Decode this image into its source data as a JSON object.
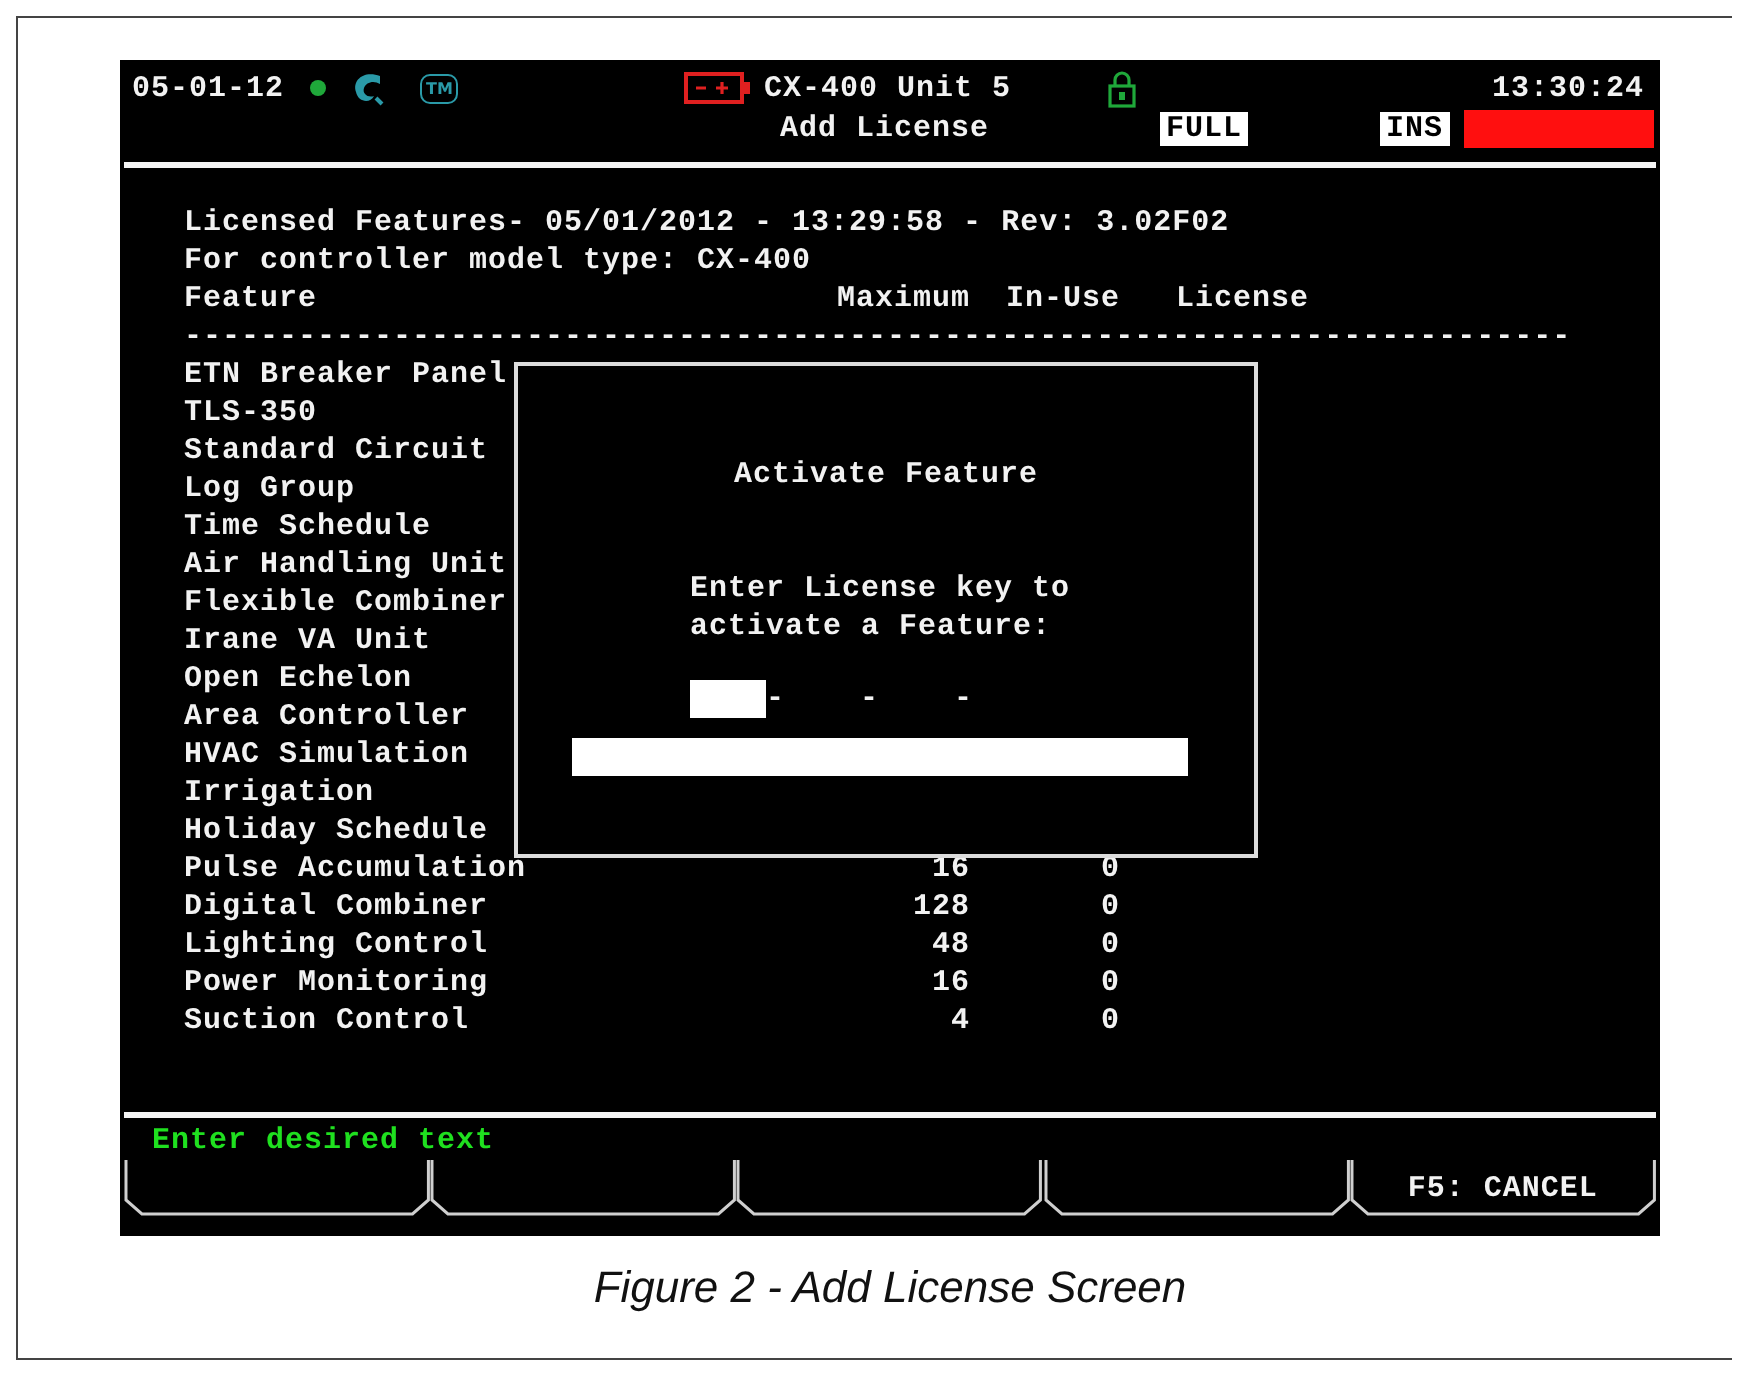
{
  "header": {
    "date": "05-01-12",
    "tm_badge": "TM",
    "unit": "CX-400 Unit 5",
    "time": "13:30:24",
    "screen_title": "Add License",
    "mode_badges": [
      "FULL",
      "INS"
    ]
  },
  "report": {
    "title_line": "Licensed Features- 05/01/2012 - 13:29:58 - Rev: 3.02F02",
    "model_line": "For controller model type: CX-400",
    "columns": [
      "Feature",
      "Maximum",
      "In-Use",
      "License"
    ],
    "rule": "-------------------------------------------------------------------------",
    "rows": [
      {
        "feature": "ETN Breaker Panel"
      },
      {
        "feature": "TLS-350"
      },
      {
        "feature": "Standard Circuit"
      },
      {
        "feature": "Log Group"
      },
      {
        "feature": "Time Schedule"
      },
      {
        "feature": "Air Handling Unit"
      },
      {
        "feature": "Flexible Combiner"
      },
      {
        "feature": "Irane VA Unit"
      },
      {
        "feature": "Open Echelon"
      },
      {
        "feature": "Area Controller"
      },
      {
        "feature": "HVAC Simulation"
      },
      {
        "feature": "Irrigation"
      },
      {
        "feature": "Holiday Schedule"
      },
      {
        "feature": "Pulse Accumulation",
        "maximum": "16",
        "in_use": "0"
      },
      {
        "feature": "Digital Combiner",
        "maximum": "128",
        "in_use": "0"
      },
      {
        "feature": "Lighting Control",
        "maximum": "48",
        "in_use": "0"
      },
      {
        "feature": "Power Monitoring",
        "maximum": "16",
        "in_use": "0"
      },
      {
        "feature": "Suction Control",
        "maximum": "4",
        "in_use": "0"
      }
    ]
  },
  "dialog": {
    "title": "Activate Feature",
    "prompt_lines": [
      "Enter License key to",
      "activate a Feature:"
    ],
    "key_segments": [
      {
        "selected": true,
        "separator": "-"
      },
      {
        "selected": false,
        "separator": "-"
      },
      {
        "selected": false,
        "separator": "-"
      },
      {
        "selected": false
      }
    ]
  },
  "status_bar": "Enter desired text",
  "softkeys": [
    {
      "kind": "empty"
    },
    {
      "kind": "empty"
    },
    {
      "kind": "empty"
    },
    {
      "kind": "empty"
    },
    {
      "kind": "labelled",
      "label": "F5: CANCEL"
    }
  ],
  "caption": "Figure 2  - Add License Screen"
}
